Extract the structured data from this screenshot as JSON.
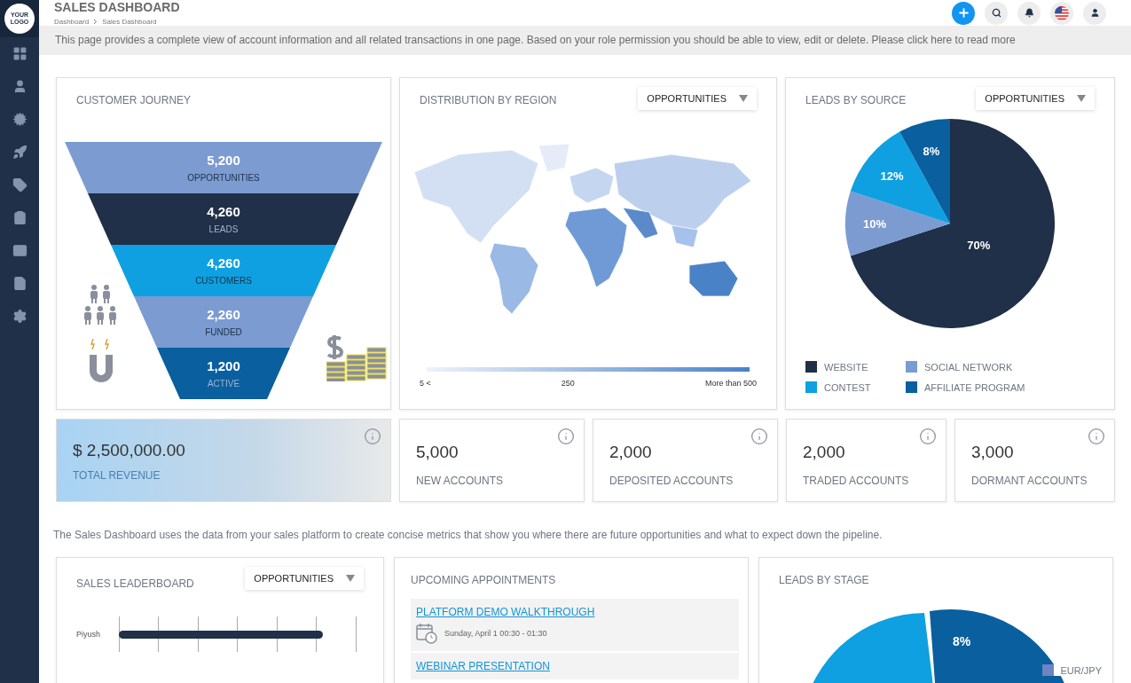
{
  "header": {
    "logo": "YOUR LOGO",
    "title": "SALES DASHBOARD",
    "breadcrumb": [
      "Dashboard",
      "Sales Dashboard"
    ]
  },
  "banner": "This page provides a complete view of account information and all related transactions in one page. Based on your role permission you should be able to view, edit or delete. Please click here to read more",
  "customer_journey": {
    "title": "CUSTOMER JOURNEY",
    "stages": [
      {
        "value": "5,200",
        "label": "OPPORTUNITIES",
        "color": "#7b9bd1"
      },
      {
        "value": "4,260",
        "label": "LEADS",
        "color": "#1f3048"
      },
      {
        "value": "4,260",
        "label": "CUSTOMERS",
        "color": "#0ea0e0"
      },
      {
        "value": "2,260",
        "label": "FUNDED",
        "color": "#7b9bd1"
      },
      {
        "value": "1,200",
        "label": "ACTIVE",
        "color": "#0a5f9e"
      }
    ]
  },
  "distribution": {
    "title": "DISTRIBUTION BY REGION",
    "dropdown": "OPPORTUNITIES",
    "legend": [
      "5 <",
      "250",
      "More than 500"
    ]
  },
  "leads_by_source": {
    "title": "LEADS BY SOURCE",
    "dropdown": "OPPORTUNITIES",
    "chart_data": {
      "type": "pie",
      "categories": [
        "WEBSITE",
        "SOCIAL NETWORK",
        "CONTEST",
        "AFFILIATE PROGRAM"
      ],
      "series": [
        {
          "values": [
            70,
            10,
            12,
            8
          ]
        }
      ],
      "value_labels": [
        "70%",
        "10%",
        "12%",
        "8%"
      ]
    },
    "legend": [
      {
        "color": "#1f3048"
      },
      {
        "color": "#7b9bd1"
      },
      {
        "color": "#0ea0e0"
      },
      {
        "color": "#0a5f9e"
      }
    ]
  },
  "revenue": {
    "value": "$ 2,500,000.00",
    "label": "TOTAL REVENUE"
  },
  "stats": [
    {
      "value": "5,000",
      "label": "NEW ACCOUNTS"
    },
    {
      "value": "2,000",
      "label": "DEPOSITED ACCOUNTS"
    },
    {
      "value": "2,000",
      "label": "TRADED ACCOUNTS"
    },
    {
      "value": "3,000",
      "label": "DORMANT ACCOUNTS"
    }
  ],
  "note": "The Sales Dashboard uses the data from your sales platform to create concise metrics that show you where there are future opportunities and what to expect down the pipeline.",
  "leaderboard": {
    "title": "SALES LEADERBOARD",
    "dropdown": "OPPORTUNITIES",
    "rows": [
      {
        "name": "Piyush",
        "level": 0.86
      }
    ]
  },
  "appointments": {
    "title": "UPCOMING APPOINTMENTS",
    "items": [
      {
        "title": "PLATFORM DEMO WALKTHROUGH",
        "time": "Sunday, April 1 00:30 - 01:30"
      },
      {
        "title": "WEBINAR PRESENTATION"
      }
    ]
  },
  "leads_by_stage": {
    "title": "LEADS BY STAGE",
    "slice_label": "8%",
    "legend": [
      {
        "label": "EUR/JPY",
        "color": "#6f84c2"
      }
    ]
  }
}
